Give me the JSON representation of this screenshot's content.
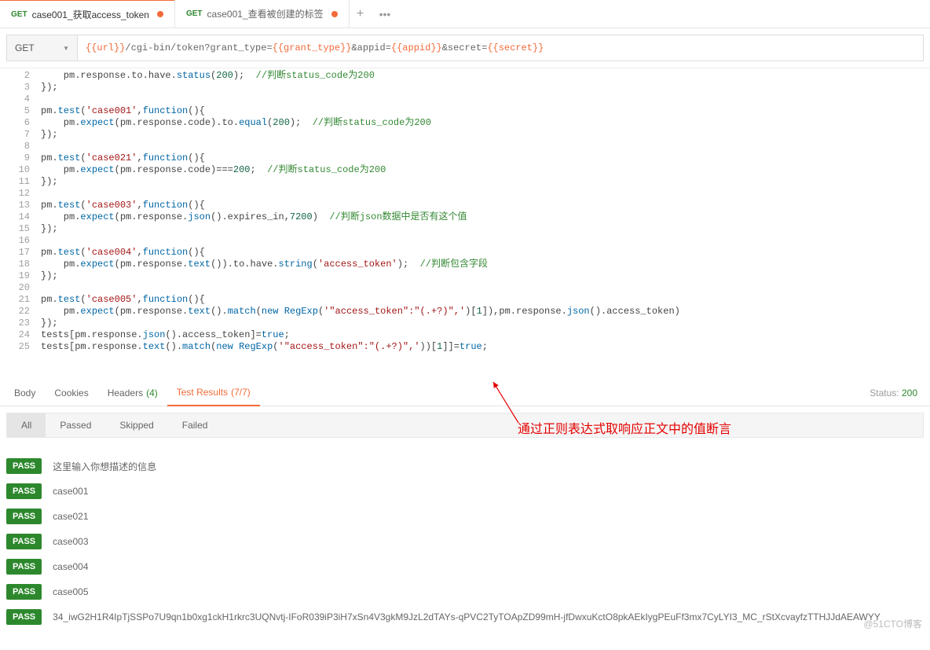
{
  "tabs": [
    {
      "method": "GET",
      "label": "case001_获取access_token"
    },
    {
      "method": "GET",
      "label": "case001_查看被创建的标签"
    }
  ],
  "tab_plus": "+",
  "tab_more": "•••",
  "request": {
    "method": "GET",
    "url_parts": {
      "p0": "{{url}}",
      "p1": "/cgi-bin/token?grant_type=",
      "p2": "{{grant_type}}",
      "p3": "&appid=",
      "p4": "{{appid}}",
      "p5": "&secret=",
      "p6": "{{secret}}"
    }
  },
  "line_numbers": [
    "2",
    "3",
    "4",
    "5",
    "6",
    "7",
    "8",
    "9",
    "10",
    "11",
    "12",
    "13",
    "14",
    "15",
    "16",
    "17",
    "18",
    "19",
    "20",
    "21",
    "22",
    "23",
    "24",
    "25"
  ],
  "annotation": "通过正则表达式取响应正文中的值断言",
  "resp_tabs": {
    "body": "Body",
    "cookies": "Cookies",
    "headers": "Headers",
    "headers_count": "(4)",
    "test_results": "Test Results",
    "test_count": "(7/7)"
  },
  "status_label": "Status:",
  "status_value": "200",
  "filters": {
    "all": "All",
    "passed": "Passed",
    "skipped": "Skipped",
    "failed": "Failed"
  },
  "pass_label": "PASS",
  "results": [
    "这里输入你想描述的信息",
    "case001",
    "case021",
    "case003",
    "case004",
    "case005",
    "34_iwG2H1R4IpTjSSPo7U9qn1b0xg1ckH1rkrc3UQNvtj-IFoR039iP3iH7xSn4V3gkM9JzL2dTAYs-qPVC2TyTOApZD99mH-jfDwxuKctO8pkAEkIygPEuFf3mx7CyLYI3_MC_rStXcvayfzTTHJJdAEAWYY"
  ],
  "watermark": "@51CTO博客"
}
